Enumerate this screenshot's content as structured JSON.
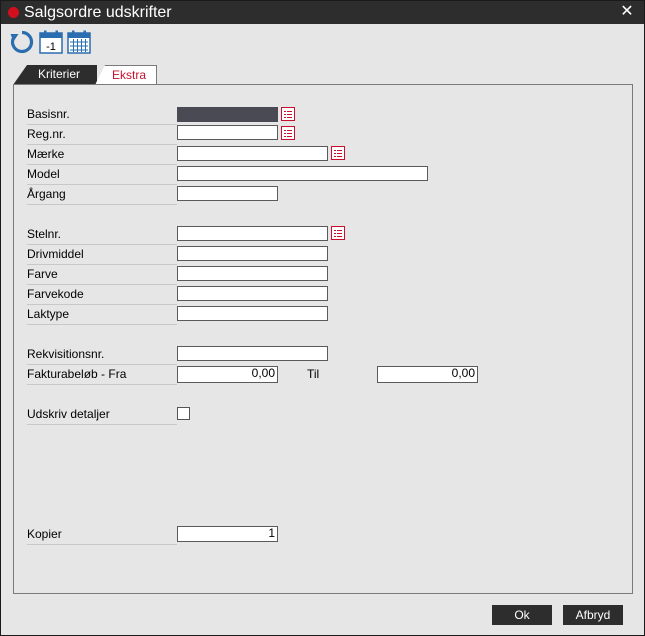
{
  "window": {
    "title": "Salgsordre udskrifter",
    "close_glyph": "✕",
    "accent": "#c8102e"
  },
  "toolbar": {
    "refresh_icon": "refresh-icon",
    "calendar_minus_label": "-1",
    "calendar_icon": "calendar-icon"
  },
  "tabs": [
    {
      "label": "Kriterier",
      "active": false
    },
    {
      "label": "Ekstra",
      "active": true
    }
  ],
  "form": {
    "basisnr": {
      "label": "Basisnr.",
      "value": ""
    },
    "regnr": {
      "label": "Reg.nr.",
      "value": ""
    },
    "maerke": {
      "label": "Mærke",
      "value": ""
    },
    "model": {
      "label": "Model",
      "value": ""
    },
    "aargang": {
      "label": "Årgang",
      "value": ""
    },
    "stelnr": {
      "label": "Stelnr.",
      "value": ""
    },
    "drivmiddel": {
      "label": "Drivmiddel",
      "value": ""
    },
    "farve": {
      "label": "Farve",
      "value": ""
    },
    "farvekode": {
      "label": "Farvekode",
      "value": ""
    },
    "laktype": {
      "label": "Laktype",
      "value": ""
    },
    "rekvisitionsnr": {
      "label": "Rekvisitionsnr.",
      "value": ""
    },
    "fakturabelob": {
      "label": "Fakturabeløb - Fra",
      "from_value": "0,00",
      "to_label": "Til",
      "to_value": "0,00"
    },
    "udskriv_detaljer": {
      "label": "Udskriv detaljer",
      "checked": false
    },
    "kopier": {
      "label": "Kopier",
      "value": "1"
    }
  },
  "buttons": {
    "ok": "Ok",
    "cancel": "Afbryd"
  }
}
